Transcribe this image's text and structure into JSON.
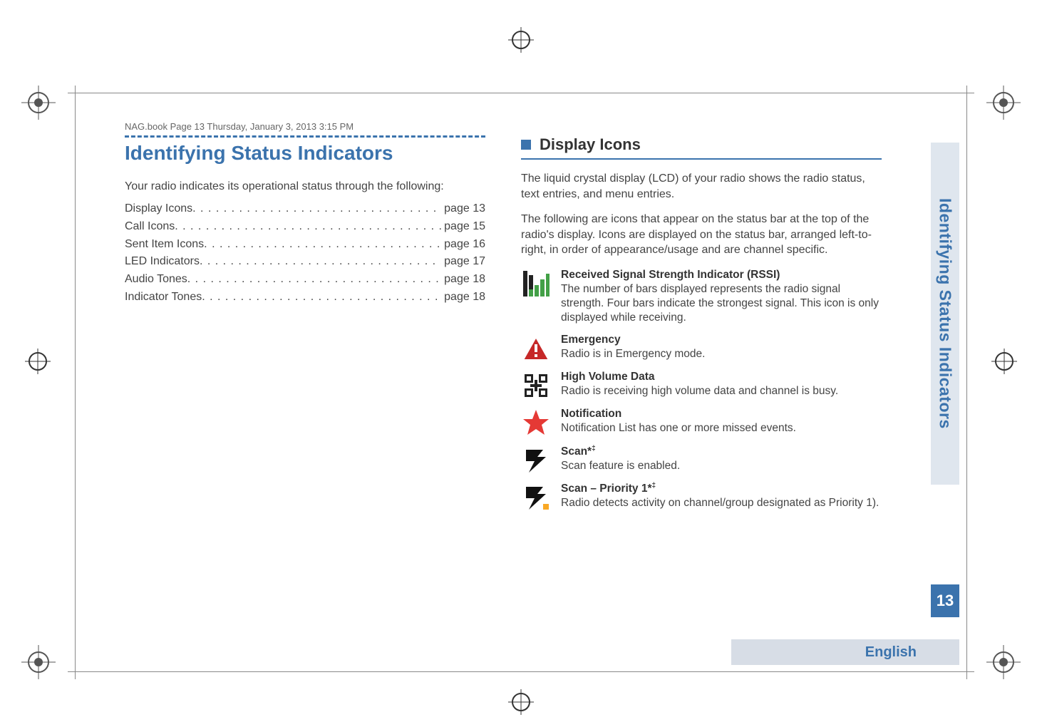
{
  "header": {
    "book_line": "NAG.book  Page 13  Thursday, January 3, 2013  3:15 PM"
  },
  "left": {
    "heading": "Identifying Status Indicators",
    "intro": "Your radio indicates its operational status through the following:",
    "toc": [
      {
        "label": "Display Icons",
        "page": "page 13"
      },
      {
        "label": "Call Icons",
        "page": "page 15"
      },
      {
        "label": "Sent Item Icons",
        "page": "page 16"
      },
      {
        "label": "LED Indicators",
        "page": "page 17"
      },
      {
        "label": "Audio Tones",
        "page": "page 18"
      },
      {
        "label": "Indicator Tones",
        "page": "page 18"
      }
    ]
  },
  "right": {
    "subheading": "Display Icons",
    "para1": "The liquid crystal display (LCD) of your radio shows the radio status, text entries, and menu entries.",
    "para2": "The following are icons that appear on the status bar at the top of the radio's display. Icons are displayed on the status bar, arranged left-to-right, in order of appearance/usage and are channel specific.",
    "icons": [
      {
        "title": "Received Signal Strength Indicator (RSSI)",
        "desc": "The number of bars displayed represents the radio signal strength. Four bars indicate the strongest signal. This icon is only displayed while receiving."
      },
      {
        "title": "Emergency",
        "desc": "Radio is in Emergency mode."
      },
      {
        "title": "High Volume Data",
        "desc": "Radio is receiving high volume data and channel is busy."
      },
      {
        "title": "Notification",
        "desc": "Notification List has one or more missed events."
      },
      {
        "title": "Scan*",
        "sup": "‡",
        "desc": "Scan feature is enabled."
      },
      {
        "title": "Scan – Priority 1*",
        "sup": "‡",
        "desc": "Radio detects activity on channel/group designated as Priority 1)."
      }
    ]
  },
  "tabs": {
    "side": "Identifying Status Indicators",
    "page_num": "13",
    "language": "English"
  }
}
